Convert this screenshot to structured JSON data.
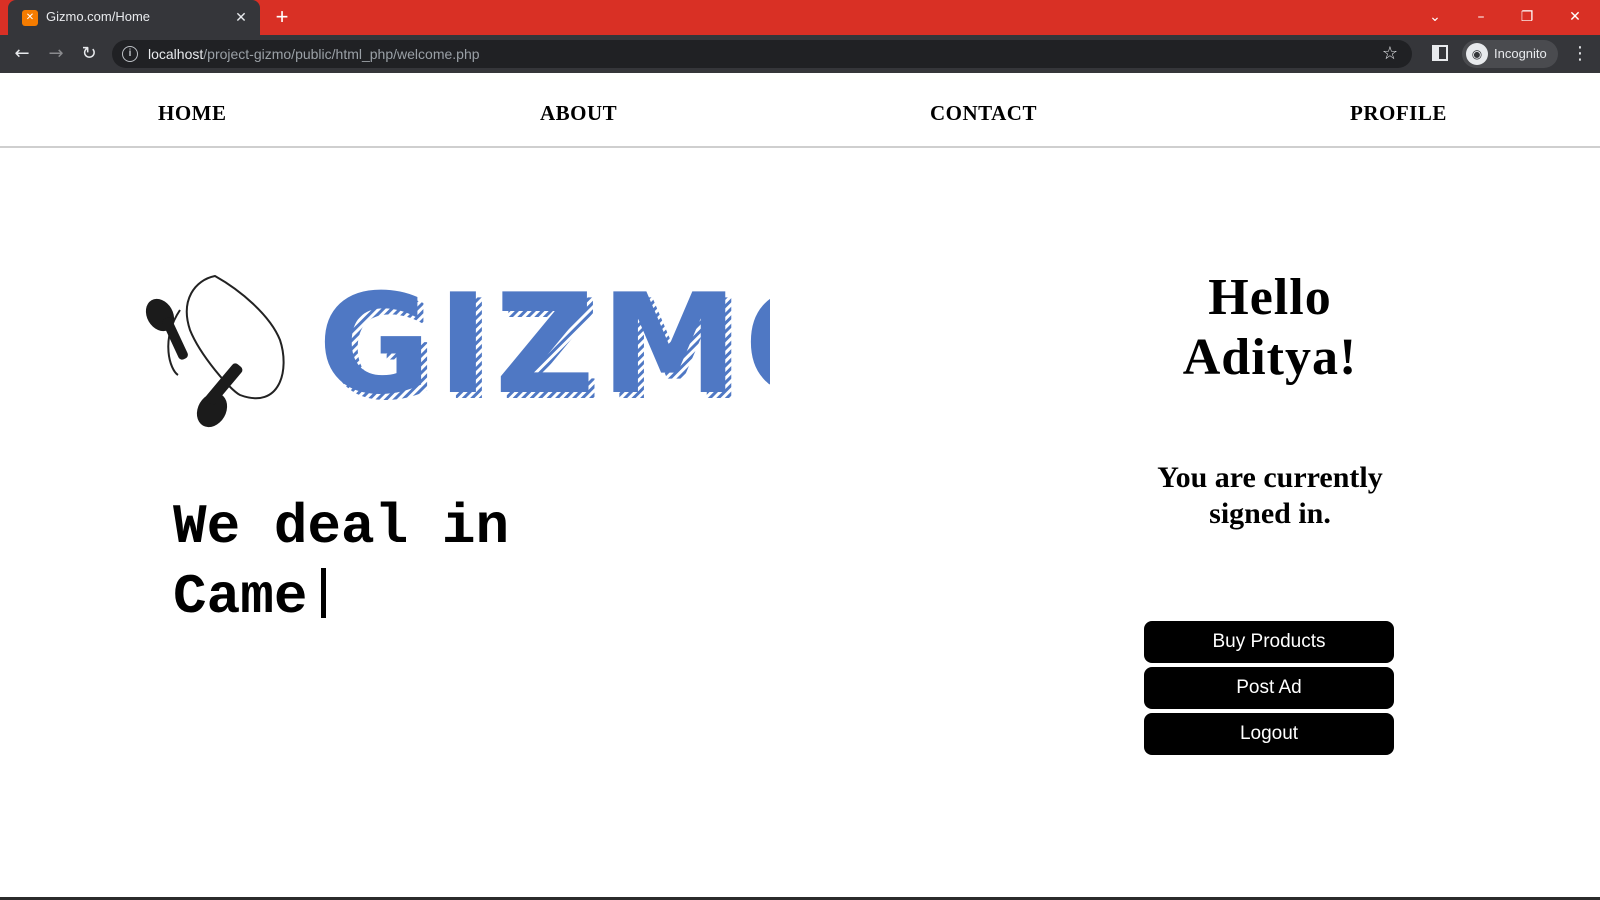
{
  "browser": {
    "tab_title": "Gizmo.com/Home",
    "url_host": "localhost",
    "url_path": "/project-gizmo/public/html_php/welcome.php",
    "profile_label": "Incognito",
    "chrome_color": "#d93025",
    "toolbar_color": "#35363a"
  },
  "nav": {
    "items": [
      {
        "label": "HOME"
      },
      {
        "label": "ABOUT"
      },
      {
        "label": "CONTACT"
      },
      {
        "label": "PROFILE"
      }
    ]
  },
  "hero": {
    "logo_text": "GIZMO",
    "logo_color": "#4f78c4",
    "tagline_line1": "We deal in",
    "tagline_line2": "Came"
  },
  "account": {
    "greeting": "Hello Aditya!",
    "status": "You are currently signed in.",
    "buttons": [
      {
        "label": "Buy Products"
      },
      {
        "label": "Post Ad"
      },
      {
        "label": "Logout"
      }
    ]
  }
}
